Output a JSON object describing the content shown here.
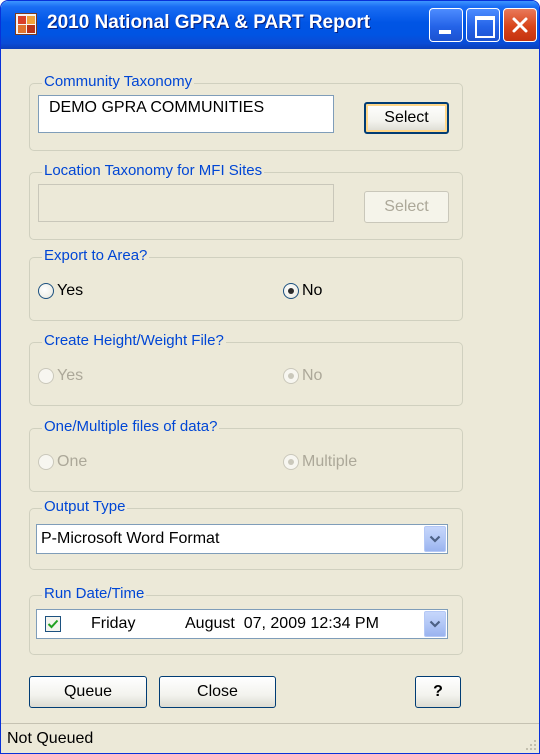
{
  "window": {
    "title": "2010 National GPRA & PART Report"
  },
  "community_taxonomy": {
    "label": "Community Taxonomy",
    "value": "DEMO GPRA COMMUNITIES",
    "select_label": "Select"
  },
  "location_taxonomy": {
    "label": "Location Taxonomy for MFI Sites",
    "value": "",
    "select_label": "Select"
  },
  "export_to_area": {
    "label": "Export to Area?",
    "options": [
      "Yes",
      "No"
    ],
    "selected": "No"
  },
  "height_weight": {
    "label": "Create Height/Weight File?",
    "options": [
      "Yes",
      "No"
    ],
    "selected": "No",
    "enabled": false
  },
  "files_of_data": {
    "label": "One/Multiple files of data?",
    "options": [
      "One",
      "Multiple"
    ],
    "selected": "Multiple",
    "enabled": false
  },
  "output_type": {
    "label": "Output Type",
    "selected": "P-Microsoft Word Format"
  },
  "run_date": {
    "label": "Run Date/Time",
    "checked": true,
    "day": "Friday",
    "date": "August  07, 2009 12:34 PM"
  },
  "buttons": {
    "queue": "Queue",
    "close": "Close",
    "help": "?"
  },
  "status": {
    "text": "Not Queued"
  },
  "icons": {
    "app": "report-app-icon",
    "minimize": "minimize-icon",
    "maximize": "maximize-icon",
    "close": "close-icon",
    "dropdown": "chevron-down-icon",
    "checkbox": "checkmark-icon",
    "grip": "resize-grip-icon"
  },
  "colors": {
    "titlebar": "#0054e3",
    "group_title": "#0046d5",
    "window_bg": "#ece9d8",
    "radio_dot": "#21a121"
  }
}
